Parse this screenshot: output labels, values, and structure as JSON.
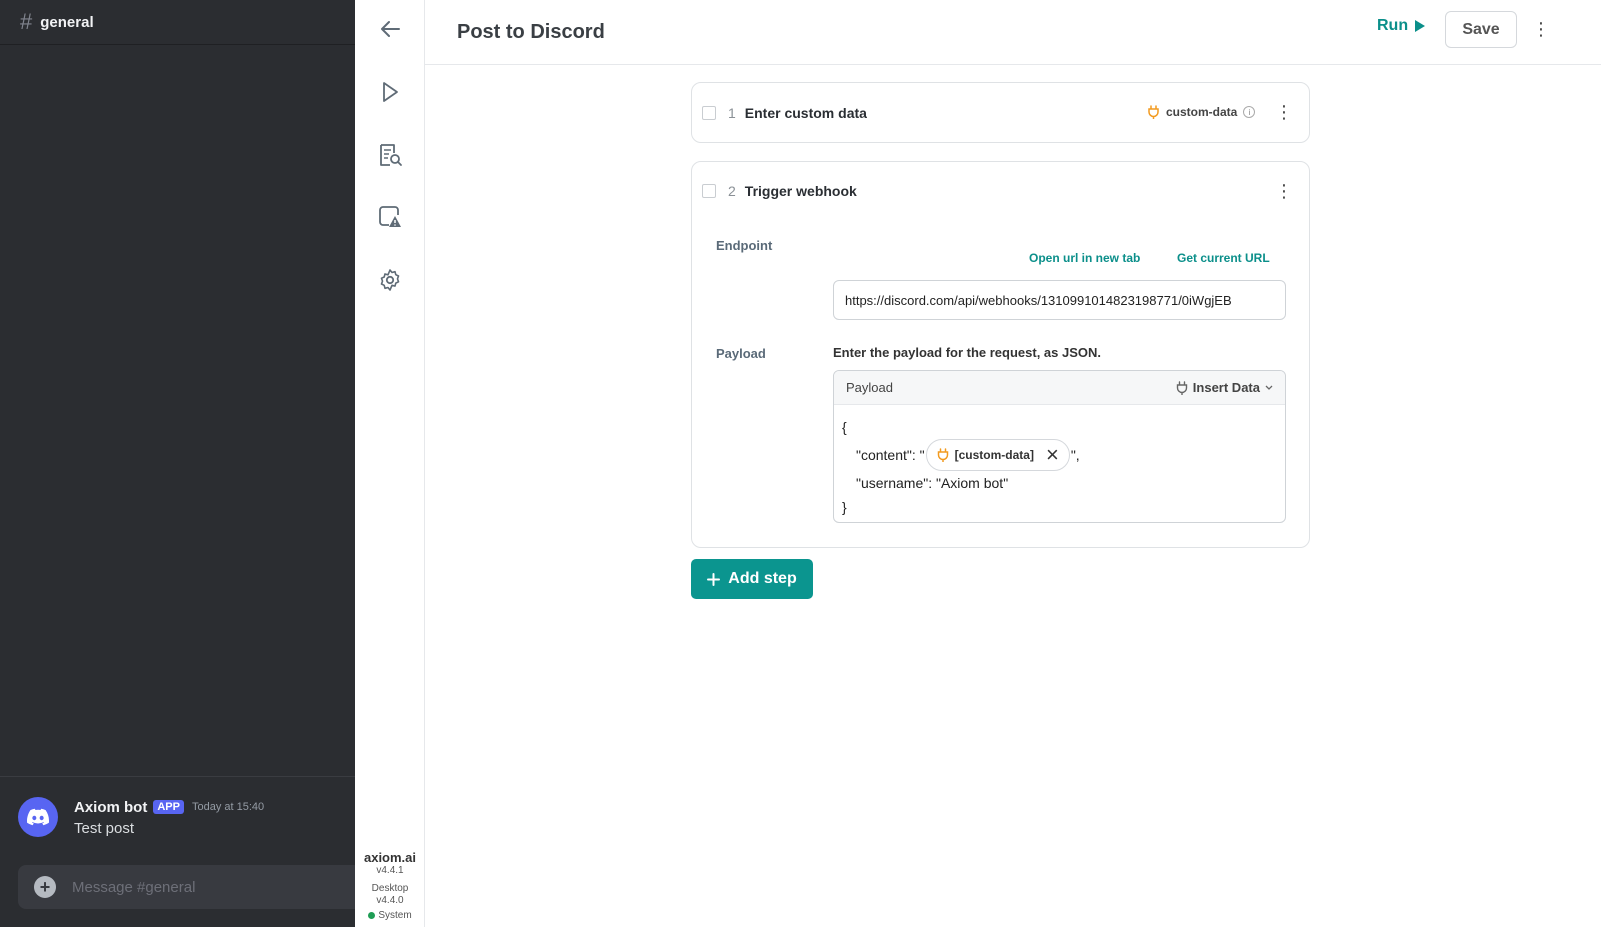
{
  "discord": {
    "channel": "general",
    "message": {
      "author": "Axiom bot",
      "badge": "APP",
      "time": "Today at 15:40",
      "text": "Test post"
    },
    "input_placeholder": "Message #general"
  },
  "rail": {
    "brand": "axiom.ai",
    "version": "v4.4.1",
    "desktop_label": "Desktop",
    "desktop_version": "v4.4.0",
    "status": "System"
  },
  "header": {
    "title": "Post to Discord",
    "run_label": "Run",
    "save_label": "Save"
  },
  "steps": [
    {
      "number": "1",
      "title": "Enter custom data",
      "data_chip": "custom-data"
    },
    {
      "number": "2",
      "title": "Trigger webhook",
      "endpoint_label": "Endpoint",
      "open_url_label": "Open url in new tab",
      "get_url_label": "Get current URL",
      "endpoint_value": "https://discord.com/api/webhooks/1310991014823198771/0iWgjEB",
      "payload_label": "Payload",
      "payload_hint": "Enter the payload for the request, as JSON.",
      "payload_box_label": "Payload",
      "insert_data_label": "Insert Data",
      "code": {
        "open": "{",
        "content_key": "\"content\": \"",
        "content_token": "[custom-data]",
        "content_end": "\",",
        "username_line": "\"username\": \"Axiom bot\"",
        "close": "}"
      }
    }
  ],
  "add_step_label": "Add step",
  "colors": {
    "accent": "#0b958f",
    "discord_bg": "#2b2d31",
    "discord_blurple": "#5865f2",
    "data_orange": "#f29a1f"
  }
}
